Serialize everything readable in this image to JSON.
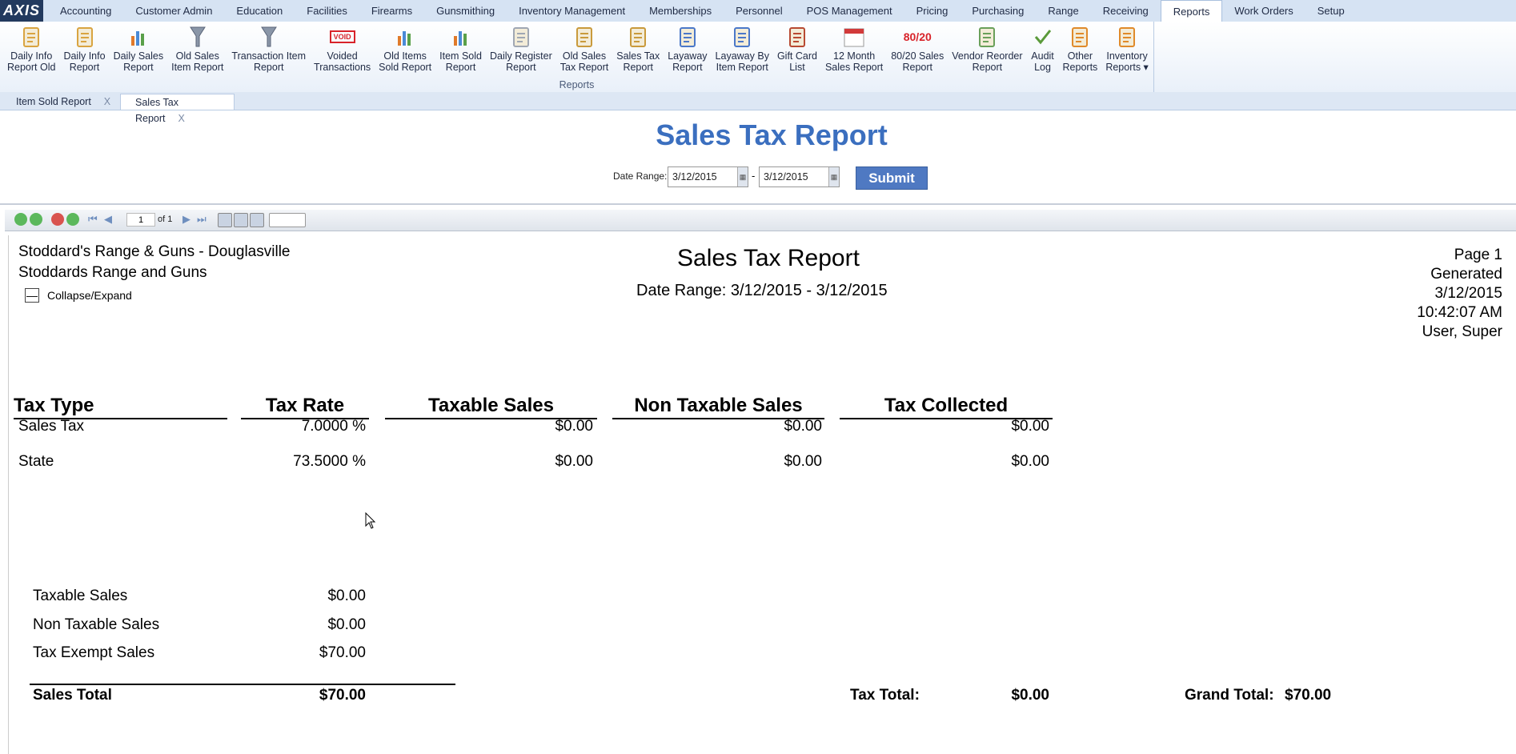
{
  "app": {
    "logo": "AXIS"
  },
  "menu": [
    "Accounting",
    "Customer Admin",
    "Education",
    "Facilities",
    "Firearms",
    "Gunsmithing",
    "Inventory Management",
    "Memberships",
    "Personnel",
    "POS Management",
    "Pricing",
    "Purchasing",
    "Range",
    "Receiving",
    "Reports",
    "Work Orders",
    "Setup"
  ],
  "menu_active": "Reports",
  "ribbon": {
    "group_label": "Reports",
    "buttons": [
      {
        "label": "Daily Info\nReport Old",
        "icon": "clipboard-icon"
      },
      {
        "label": "Daily Info\nReport",
        "icon": "clipboard-icon"
      },
      {
        "label": "Daily Sales\nReport",
        "icon": "bar-chart-icon"
      },
      {
        "label": "Old Sales\nItem Report",
        "icon": "funnel-icon"
      },
      {
        "label": "Transaction Item\nReport",
        "icon": "funnel-icon"
      },
      {
        "label": "Voided\nTransactions",
        "icon": "void-stamp-icon"
      },
      {
        "label": "Old Items\nSold Report",
        "icon": "bar-chart-icon"
      },
      {
        "label": "Item Sold\nReport",
        "icon": "bar-chart-icon"
      },
      {
        "label": "Daily Register\nReport",
        "icon": "register-icon"
      },
      {
        "label": "Old Sales\nTax Report",
        "icon": "tax-icon"
      },
      {
        "label": "Sales Tax\nReport",
        "icon": "tax-icon"
      },
      {
        "label": "Layaway\nReport",
        "icon": "layaway-icon"
      },
      {
        "label": "Layaway By\nItem Report",
        "icon": "layaway-icon"
      },
      {
        "label": "Gift Card\nList",
        "icon": "gift-card-icon"
      },
      {
        "label": "12 Month\nSales Report",
        "icon": "calendar-icon"
      },
      {
        "label": "80/20 Sales\nReport",
        "icon": "eighty-twenty-icon",
        "icon_text": "80/20"
      },
      {
        "label": "Vendor Reorder\nReport",
        "icon": "reorder-icon"
      },
      {
        "label": "Audit\nLog",
        "icon": "checkmark-icon"
      },
      {
        "label": "Other\nReports",
        "icon": "reports-icon"
      },
      {
        "label": "Inventory\nReports ▾",
        "icon": "reports-icon"
      }
    ]
  },
  "doc_tabs": [
    {
      "label": "Item Sold Report",
      "close": "X",
      "active": false
    },
    {
      "label": "Sales Tax Report",
      "close": "X",
      "active": true
    }
  ],
  "header": {
    "title": "Sales Tax Report",
    "date_range_label": "Date Range:",
    "start_date": "3/12/2015",
    "end_date": "3/12/2015",
    "separator": "-",
    "submit_label": "Submit"
  },
  "toolbar": {
    "page": "1",
    "of": "of 1"
  },
  "report": {
    "company_line1": "Stoddard's Range & Guns - Douglasville",
    "company_line2": "Stoddards Range and Guns",
    "collapse_label": "Collapse/Expand",
    "collapse_symbol": "—",
    "title": "Sales Tax Report",
    "date_range": "Date Range: 3/12/2015 - 3/12/2015",
    "meta": {
      "page": "Page 1",
      "generated": "Generated",
      "date": "3/12/2015",
      "time": "10:42:07 AM",
      "user": "User, Super"
    },
    "columns": [
      "Tax Type",
      "Tax Rate",
      "Taxable Sales",
      "Non Taxable Sales",
      "Tax Collected"
    ],
    "rows": [
      [
        "Sales Tax",
        "7.0000 %",
        "$0.00",
        "$0.00",
        "$0.00"
      ],
      [
        "State",
        "73.5000 %",
        "$0.00",
        "$0.00",
        "$0.00"
      ]
    ],
    "summary": [
      {
        "label": "Taxable Sales",
        "value": "$0.00"
      },
      {
        "label": "Non Taxable Sales",
        "value": "$0.00"
      },
      {
        "label": "Tax Exempt Sales",
        "value": "$70.00"
      }
    ],
    "sales_total": {
      "label": "Sales Total",
      "value": "$70.00"
    },
    "tax_total": {
      "label": "Tax Total:",
      "value": "$0.00"
    },
    "grand_total": {
      "label": "Grand Total:",
      "value": "$70.00"
    }
  }
}
